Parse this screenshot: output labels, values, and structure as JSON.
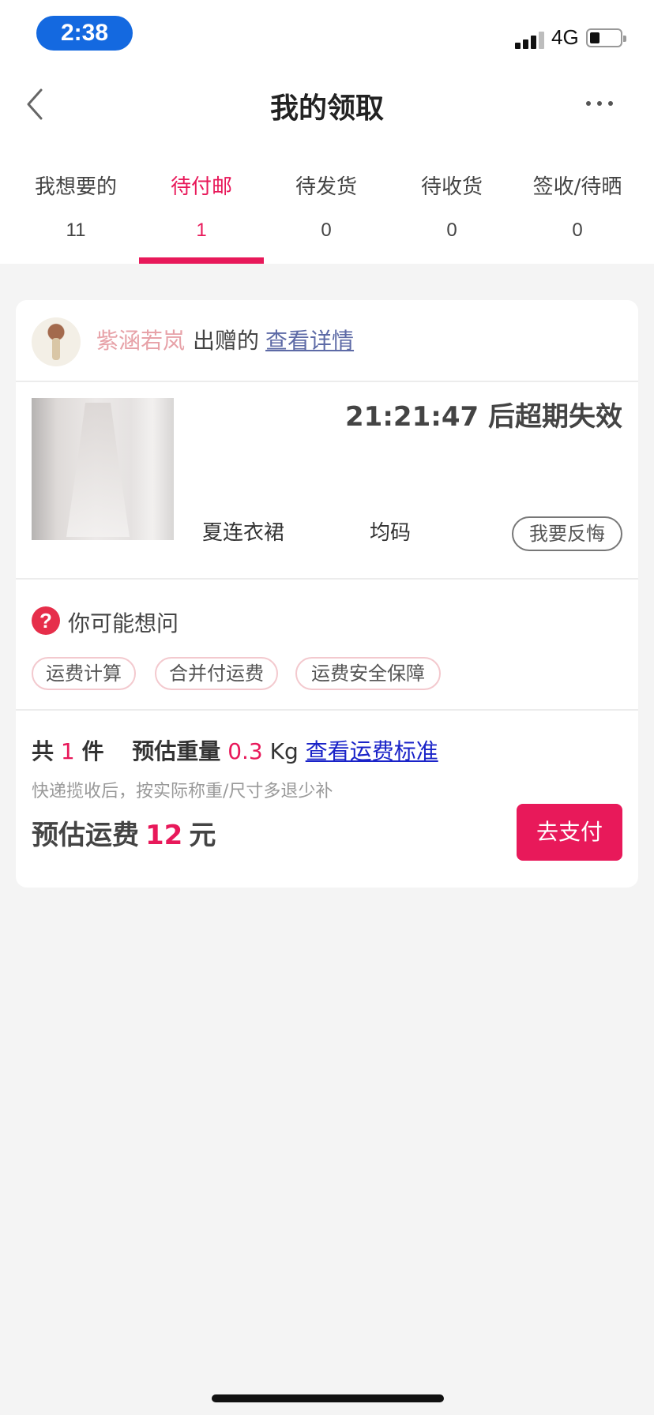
{
  "status_bar": {
    "time": "2:38",
    "network": "4G"
  },
  "nav": {
    "title": "我的领取"
  },
  "tabs": [
    {
      "label": "我想要的",
      "count": "11"
    },
    {
      "label": "待付邮",
      "count": "1"
    },
    {
      "label": "待发货",
      "count": "0"
    },
    {
      "label": "待收货",
      "count": "0"
    },
    {
      "label": "签收/待晒",
      "count": "0"
    }
  ],
  "active_tab_index": 1,
  "card": {
    "donor_name": "紫涵若岚",
    "donor_action": "出赠的",
    "view_detail": "查看详情",
    "countdown": "21:21:47 后超期失效",
    "item_name": "夏连衣裙",
    "item_size": "均码",
    "regret_button": "我要反悔",
    "faq_title": "你可能想问",
    "faq_chips": [
      "运费计算",
      "合并付运费",
      "运费安全保障"
    ],
    "summary": {
      "total_prefix": "共",
      "total_count": "1",
      "total_suffix": "件",
      "weight_label": "预估重量",
      "weight_value": "0.3",
      "weight_unit": "Kg",
      "fee_standard_link": "查看运费标准",
      "note": "快递揽收后，按实际称重/尺寸多退少补",
      "fee_label": "预估运费",
      "fee_value": "12",
      "fee_unit": "元"
    },
    "pay_button": "去支付"
  },
  "colors": {
    "accent": "#e8195a",
    "status_pill": "#1469e0",
    "donor_name": "#e7a2a8",
    "link": "#1a23c8",
    "detail_link": "#5d6aa6"
  }
}
